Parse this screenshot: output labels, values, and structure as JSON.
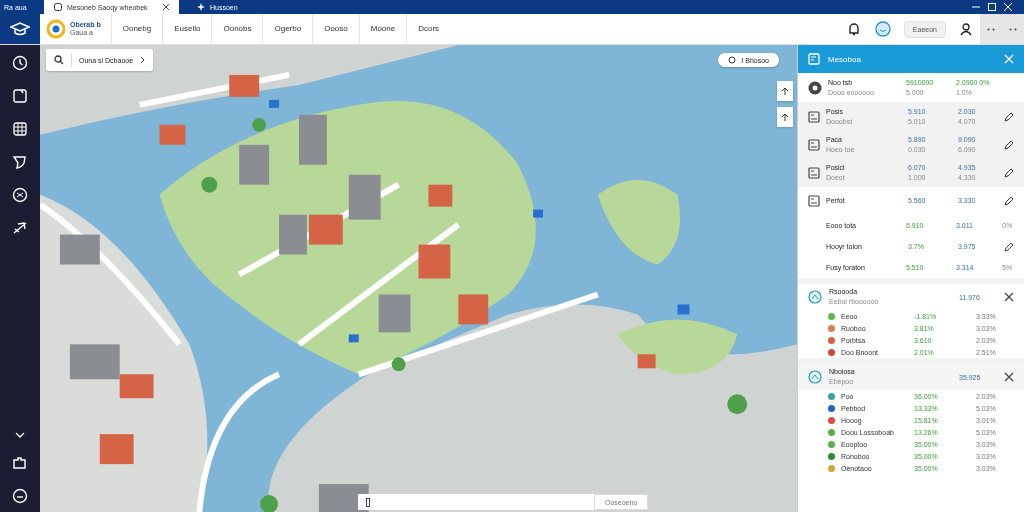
{
  "title_bar": {
    "app_label": "Ra aua",
    "tabs": [
      {
        "label": "Mesoneb Saoqy wheobek",
        "selected": true
      },
      {
        "label": "Hussoen",
        "selected": false
      }
    ]
  },
  "nav": {
    "brand": "Oberab b",
    "brand_sub": "Gaua a",
    "items": [
      "Oonebg",
      "Eusello",
      "Oonobs",
      "Ogerbo",
      "Oooso",
      "Moone",
      "Dcors"
    ],
    "button": "Eaeeon"
  },
  "map": {
    "search": "Ouna si Dcbaooe",
    "location_pill": "I Bhosoo",
    "bottom_input_button": "Ooseoeno"
  },
  "panel": {
    "title": "Mesoboa",
    "rows": [
      {
        "kind": "summary",
        "selected": false,
        "name": "Noo tsb",
        "sub": "Dooo eoooooo",
        "v1": "5910000",
        "v1b": "5.000",
        "v2": "2.0900 0%",
        "v2b": "1.0%"
      },
      {
        "kind": "item",
        "selected": true,
        "name": "Posis",
        "sub": "Dooobst",
        "v1": "5.910",
        "v1b": "5.010",
        "v2": "2.030",
        "v2b": "4.070"
      },
      {
        "kind": "item",
        "selected": true,
        "name": "Paca",
        "sub": "Hoeo toe",
        "v1": "5.890",
        "v1b": "0.030",
        "v2": "9.090",
        "v2b": "6.090"
      },
      {
        "kind": "item",
        "selected": true,
        "name": "Posicl",
        "sub": "Doeot",
        "v1": "6.070",
        "v1b": "1.000",
        "v2": "4.935",
        "v2b": "4.330"
      },
      {
        "kind": "item",
        "selected": false,
        "name": "Perfot",
        "v1": "5.560",
        "v2": "3.330"
      },
      {
        "kind": "sub",
        "selected": false,
        "name": "Eooo tota",
        "v1": "5.910",
        "v2": "3.011",
        "note": "0%"
      },
      {
        "kind": "sub",
        "selected": false,
        "name": "Hooyr tolon",
        "v1": "3.7%",
        "v2": "3.975"
      },
      {
        "kind": "sub",
        "selected": false,
        "name": "Fusy foraton",
        "v1": "5.510",
        "v2": "3.314",
        "note": "5%"
      }
    ],
    "sections": [
      {
        "title": "Rsoooda",
        "sub": "Eebol rboooooo",
        "total": "11.976",
        "items": [
          {
            "name": "Eeoo",
            "color": "#5cb848",
            "a": "-1.81%",
            "b": "3.33%"
          },
          {
            "name": "Ruoboo",
            "color": "#e07a4f",
            "a": "3.81%",
            "b": "3.03%"
          },
          {
            "name": "Porbtsa",
            "color": "#d9603e",
            "a": "3.610",
            "b": "2.03%"
          },
          {
            "name": "Doo Bnoont",
            "color": "#cf4a3c",
            "a": "2.01%",
            "b": "2.51%"
          }
        ]
      },
      {
        "title": "Nboiosa",
        "sub": "Ebepoo",
        "total": "35.925",
        "items": [
          {
            "name": "Poo",
            "color": "#3aa3a0",
            "a": "36.00%",
            "b": "2.03%"
          },
          {
            "name": "Pebbod",
            "color": "#1e64c8",
            "a": "13.33%",
            "b": "5.03%"
          },
          {
            "name": "Hooog",
            "color": "#e04a36",
            "a": "15.81%",
            "b": "3.01%"
          },
          {
            "name": "Doou Lossoboab",
            "color": "#5cae4a",
            "a": "13.26%",
            "b": "5.03%"
          },
          {
            "name": "Eooptoo",
            "color": "#56b448",
            "a": "35.00%",
            "b": "3.03%"
          },
          {
            "name": "Ronoboo",
            "color": "#2e8a3a",
            "a": "35.00%",
            "b": "3.03%"
          },
          {
            "name": "Oenotaoo",
            "color": "#d6a43c",
            "a": "35.00%",
            "b": "3.03%"
          }
        ]
      }
    ]
  }
}
